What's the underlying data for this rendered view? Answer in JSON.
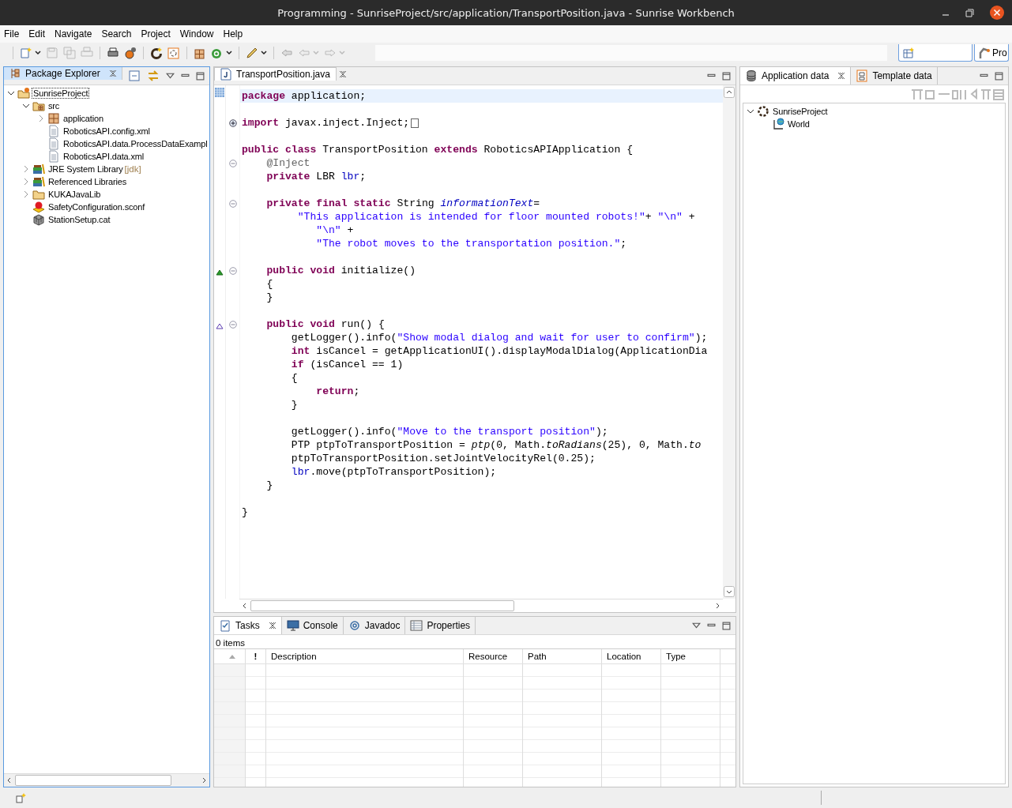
{
  "window": {
    "title": "Programming - SunriseProject/src/application/TransportPosition.java - Sunrise Workbench"
  },
  "menu": [
    "File",
    "Edit",
    "Navigate",
    "Search",
    "Project",
    "Window",
    "Help"
  ],
  "perspective": {
    "label": "Pro"
  },
  "package_explorer": {
    "tab": {
      "label": "Package Explorer",
      "selected": true
    },
    "tree": [
      {
        "label": "SunriseProject",
        "kind": "project",
        "expanded": true,
        "selected": true,
        "children": [
          {
            "label": "src",
            "kind": "src",
            "expanded": true,
            "selected": false,
            "children": [
              {
                "label": "application",
                "kind": "package",
                "expanded": false,
                "selected": false
              },
              {
                "label": "RoboticsAPI.config.xml",
                "kind": "file",
                "selected": false
              },
              {
                "label": "RoboticsAPI.data.ProcessDataExampl",
                "kind": "file",
                "selected": false
              },
              {
                "label": "RoboticsAPI.data.xml",
                "kind": "file",
                "selected": false
              }
            ]
          },
          {
            "label": "JRE System Library",
            "decoration": "[jdk]",
            "kind": "library",
            "expanded": false,
            "selected": false
          },
          {
            "label": "Referenced Libraries",
            "kind": "library",
            "expanded": false,
            "selected": false
          },
          {
            "label": "KUKAJavaLib",
            "kind": "folder",
            "expanded": false,
            "selected": false
          },
          {
            "label": "SafetyConfiguration.sconf",
            "kind": "safety",
            "selected": false
          },
          {
            "label": "StationSetup.cat",
            "kind": "station",
            "selected": false
          }
        ]
      }
    ]
  },
  "editor": {
    "tab": {
      "label": "TransportPosition.java",
      "selected": true
    },
    "lines": [
      {
        "kind": "code",
        "current": true,
        "tokens": [
          {
            "kind": "kw",
            "text": "package"
          },
          {
            "kind": "plain",
            "text": " application;"
          }
        ]
      },
      {
        "kind": "blank",
        "current": false
      },
      {
        "kind": "code",
        "current": false,
        "folded": true,
        "folded_tail": true,
        "tokens": [
          {
            "kind": "kw",
            "text": "import"
          },
          {
            "kind": "plain",
            "text": " javax.inject.Inject;"
          }
        ]
      },
      {
        "kind": "blank",
        "current": false
      },
      {
        "kind": "code",
        "current": false,
        "tokens": [
          {
            "kind": "kw",
            "text": "public class"
          },
          {
            "kind": "plain",
            "text": " TransportPosition "
          },
          {
            "kind": "kw",
            "text": "extends"
          },
          {
            "kind": "plain",
            "text": " RoboticsAPIApplication {"
          }
        ]
      },
      {
        "kind": "code",
        "current": false,
        "folded": false,
        "tokens": [
          {
            "kind": "ann",
            "text": "    @Inject"
          }
        ]
      },
      {
        "kind": "code",
        "current": false,
        "tokens": [
          {
            "kind": "kw",
            "text": "    private"
          },
          {
            "kind": "plain",
            "text": " LBR "
          },
          {
            "kind": "field",
            "text": "lbr"
          },
          {
            "kind": "plain",
            "text": ";"
          }
        ]
      },
      {
        "kind": "blank",
        "current": false
      },
      {
        "kind": "code",
        "current": false,
        "folded": false,
        "tokens": [
          {
            "kind": "kw",
            "text": "    private final static"
          },
          {
            "kind": "plain",
            "text": " String "
          },
          {
            "kind": "static_field",
            "text": "informationText"
          },
          {
            "kind": "plain",
            "text": "="
          }
        ]
      },
      {
        "kind": "code",
        "current": false,
        "tokens": [
          {
            "kind": "str",
            "text": "         \"This application is intended for floor mounted robots!\""
          },
          {
            "kind": "plain",
            "text": "+ "
          },
          {
            "kind": "str",
            "text": "\"\\n\""
          },
          {
            "kind": "plain",
            "text": " +"
          }
        ]
      },
      {
        "kind": "code",
        "current": false,
        "tokens": [
          {
            "kind": "str",
            "text": "            \"\\n\""
          },
          {
            "kind": "plain",
            "text": " +"
          }
        ]
      },
      {
        "kind": "code",
        "current": false,
        "tokens": [
          {
            "kind": "str",
            "text": "            \"The robot moves to the transportation position.\""
          },
          {
            "kind": "plain",
            "text": ";"
          }
        ]
      },
      {
        "kind": "blank",
        "current": false
      },
      {
        "kind": "code",
        "current": false,
        "folded": false,
        "overrides": true,
        "tokens": [
          {
            "kind": "kw",
            "text": "    public void"
          },
          {
            "kind": "plain",
            "text": " initialize()"
          }
        ]
      },
      {
        "kind": "code",
        "current": false,
        "tokens": [
          {
            "kind": "plain",
            "text": "    {"
          }
        ]
      },
      {
        "kind": "code",
        "current": false,
        "tokens": [
          {
            "kind": "plain",
            "text": "    }"
          }
        ]
      },
      {
        "kind": "blank",
        "current": false
      },
      {
        "kind": "code",
        "current": false,
        "folded": false,
        "implements": true,
        "tokens": [
          {
            "kind": "kw",
            "text": "    public void"
          },
          {
            "kind": "plain",
            "text": " run() {"
          }
        ]
      },
      {
        "kind": "code",
        "current": false,
        "tokens": [
          {
            "kind": "plain",
            "text": "        getLogger().info("
          },
          {
            "kind": "str",
            "text": "\"Show modal dialog and wait for user to confirm\""
          },
          {
            "kind": "plain",
            "text": ");"
          }
        ]
      },
      {
        "kind": "code",
        "current": false,
        "tokens": [
          {
            "kind": "kw",
            "text": "        int"
          },
          {
            "kind": "plain",
            "text": " isCancel = getApplicationUI().displayModalDialog(ApplicationDia"
          }
        ]
      },
      {
        "kind": "code",
        "current": false,
        "tokens": [
          {
            "kind": "kw",
            "text": "        if"
          },
          {
            "kind": "plain",
            "text": " (isCancel == 1)"
          }
        ]
      },
      {
        "kind": "code",
        "current": false,
        "tokens": [
          {
            "kind": "plain",
            "text": "        {"
          }
        ]
      },
      {
        "kind": "code",
        "current": false,
        "tokens": [
          {
            "kind": "kw",
            "text": "            return"
          },
          {
            "kind": "plain",
            "text": ";"
          }
        ]
      },
      {
        "kind": "code",
        "current": false,
        "tokens": [
          {
            "kind": "plain",
            "text": "        }"
          }
        ]
      },
      {
        "kind": "blank",
        "current": false
      },
      {
        "kind": "code",
        "current": false,
        "tokens": [
          {
            "kind": "plain",
            "text": "        getLogger().info("
          },
          {
            "kind": "str",
            "text": "\"Move to the transport position\""
          },
          {
            "kind": "plain",
            "text": ");"
          }
        ]
      },
      {
        "kind": "code",
        "current": false,
        "tokens": [
          {
            "kind": "plain",
            "text": "        PTP ptpToTransportPosition = "
          },
          {
            "kind": "static_method",
            "text": "ptp"
          },
          {
            "kind": "plain",
            "text": "(0, Math."
          },
          {
            "kind": "static_method",
            "text": "toRadians"
          },
          {
            "kind": "plain",
            "text": "(25), 0, Math."
          },
          {
            "kind": "static_method",
            "text": "to"
          }
        ]
      },
      {
        "kind": "code",
        "current": false,
        "tokens": [
          {
            "kind": "plain",
            "text": "        ptpToTransportPosition.setJointVelocityRel(0.25);"
          }
        ]
      },
      {
        "kind": "code",
        "current": false,
        "tokens": [
          {
            "kind": "field",
            "text": "        lbr"
          },
          {
            "kind": "plain",
            "text": ".move(ptpToTransportPosition);"
          }
        ]
      },
      {
        "kind": "code",
        "current": false,
        "tokens": [
          {
            "kind": "plain",
            "text": "    }"
          }
        ]
      },
      {
        "kind": "blank",
        "current": false
      },
      {
        "kind": "code",
        "current": false,
        "tokens": [
          {
            "kind": "plain",
            "text": "}"
          }
        ]
      }
    ]
  },
  "bottom_panel": {
    "tabs": [
      {
        "label": "Tasks",
        "kind": "tasks",
        "selected": true
      },
      {
        "label": "Console",
        "kind": "console",
        "selected": false
      },
      {
        "label": "Javadoc",
        "kind": "javadoc",
        "selected": false
      },
      {
        "label": "Properties",
        "kind": "properties",
        "selected": false
      }
    ],
    "count": "0 items",
    "table": {
      "columns": [
        {
          "kind": "sort"
        },
        {
          "kind": "priority",
          "label": "!"
        },
        {
          "kind": "text",
          "label": "Description"
        },
        {
          "kind": "text",
          "label": "Resource"
        },
        {
          "kind": "text",
          "label": "Path"
        },
        {
          "kind": "text",
          "label": "Location"
        },
        {
          "kind": "text",
          "label": "Type"
        }
      ]
    }
  },
  "right_panel": {
    "tabs": [
      {
        "label": "Application data",
        "kind": "appdata",
        "selected": true
      },
      {
        "label": "Template data",
        "kind": "template",
        "selected": false
      }
    ],
    "tree": [
      {
        "label": "SunriseProject",
        "kind": "project",
        "expanded": true,
        "children": [
          {
            "label": "World",
            "kind": "world"
          }
        ]
      }
    ]
  }
}
